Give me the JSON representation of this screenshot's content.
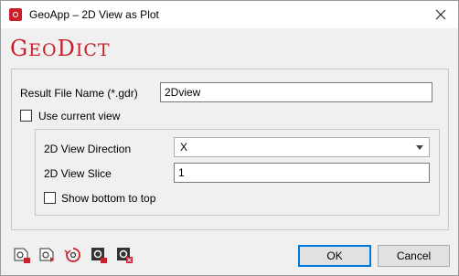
{
  "window": {
    "title": "GeoApp – 2D View as Plot",
    "logo_big_1": "G",
    "logo_small_1": "EO",
    "logo_big_2": "D",
    "logo_small_2": "ICT"
  },
  "form": {
    "result_file_label": "Result File Name (*.gdr)",
    "result_file_value": "2Dview",
    "use_current_view_label": "Use current view",
    "use_current_view_checked": false,
    "view_direction_label": "2D View Direction",
    "view_direction_value": "X",
    "view_slice_label": "2D View Slice",
    "view_slice_value": "1",
    "show_bottom_label": "Show bottom to top",
    "show_bottom_checked": false
  },
  "buttons": {
    "ok": "OK",
    "cancel": "Cancel"
  },
  "toolbar_icons": [
    "load-settings-icon",
    "save-settings-icon",
    "reset-settings-icon",
    "settings-gear-icon",
    "delete-settings-icon"
  ],
  "colors": {
    "brand": "#c8202a",
    "accent": "#0078d7"
  }
}
